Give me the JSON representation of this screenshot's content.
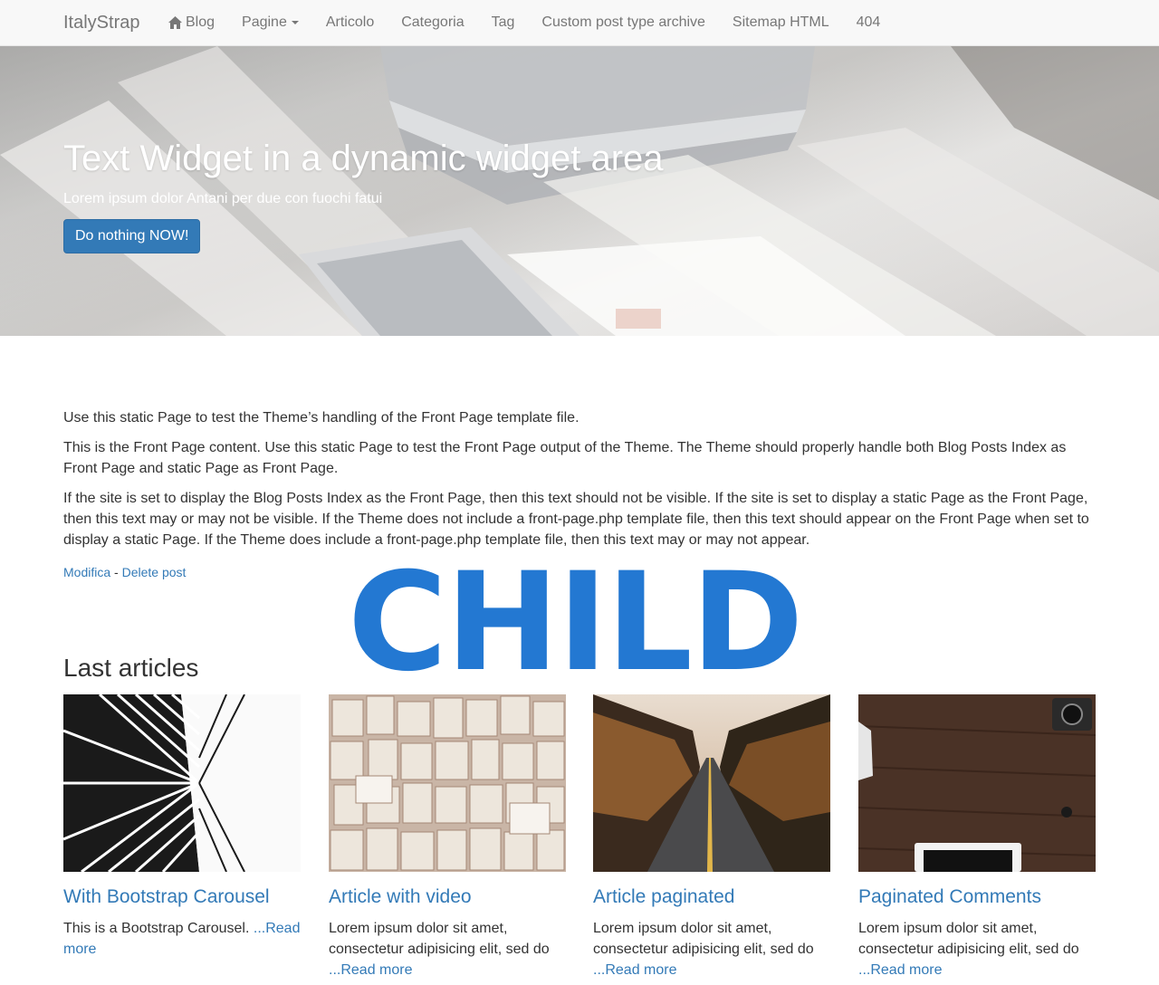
{
  "navbar": {
    "brand": "ItalyStrap",
    "items": [
      {
        "label": "Blog",
        "icon": "home-icon"
      },
      {
        "label": "Pagine",
        "dropdown": true
      },
      {
        "label": "Articolo"
      },
      {
        "label": "Categoria"
      },
      {
        "label": "Tag"
      },
      {
        "label": "Custom post type archive"
      },
      {
        "label": "Sitemap HTML"
      },
      {
        "label": "404"
      }
    ]
  },
  "hero": {
    "title": "Text Widget in a dynamic widget area",
    "subtitle": "Lorem ipsum dolor Antani per due con fuochi fatui",
    "button": "Do nothing NOW!"
  },
  "content": {
    "paragraphs": [
      "Use this static Page to test the Theme’s handling of the Front Page template file.",
      "This is the Front Page content. Use this static Page to test the Front Page output of the Theme. The Theme should properly handle both Blog Posts Index as Front Page and static Page as Front Page.",
      "If the site is set to display the Blog Posts Index as the Front Page, then this text should not be visible. If the site is set to display a static Page as the Front Page, then this text may or may not be visible. If the Theme does not include a front-page.php template file, then this text should appear on the Front Page when set to display a static Page. If the Theme does include a front-page.php template file, then this text may or may not appear."
    ],
    "edit_link": "Modifica",
    "separator": " - ",
    "delete_link": "Delete post"
  },
  "watermark": "CHILD",
  "last_articles": {
    "title": "Last articles",
    "cards": [
      {
        "title": "With Bootstrap Carousel",
        "excerpt": "This is a Bootstrap Carousel. ",
        "more": "...Read more"
      },
      {
        "title": "Article with video",
        "excerpt": "Lorem ipsum dolor sit amet, consectetur adipisicing elit, sed do ",
        "more": "...Read more"
      },
      {
        "title": "Article paginated",
        "excerpt": "Lorem ipsum dolor sit amet, consectetur adipisicing elit, sed do ",
        "more": "...Read more"
      },
      {
        "title": "Paginated Comments",
        "excerpt": "Lorem ipsum dolor sit amet, consectetur adipisicing elit, sed do ",
        "more": "...Read more"
      }
    ]
  },
  "colors": {
    "link": "#337ab7",
    "button": "#337ab7",
    "watermark": "#2378d2",
    "navbar_bg": "#f8f8f8",
    "nav_text": "#777777"
  }
}
